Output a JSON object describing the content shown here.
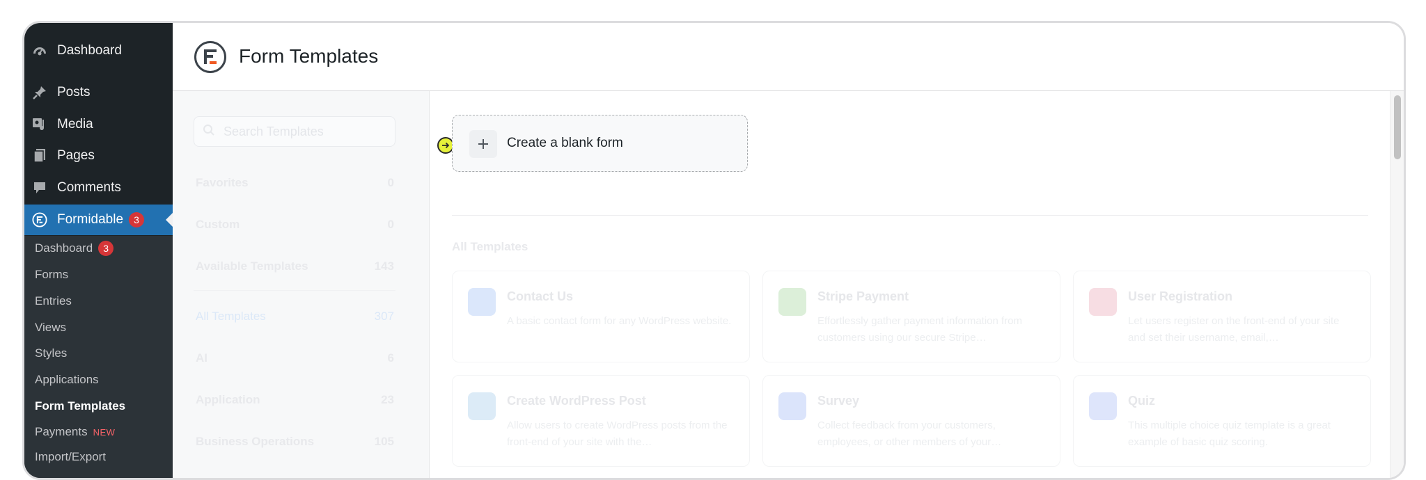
{
  "sidebar": {
    "menu": [
      {
        "label": "Dashboard",
        "icon": "dashboard-icon"
      },
      {
        "label": "Posts",
        "icon": "pin-icon"
      },
      {
        "label": "Media",
        "icon": "media-icon"
      },
      {
        "label": "Pages",
        "icon": "pages-icon"
      },
      {
        "label": "Comments",
        "icon": "comment-icon"
      },
      {
        "label": "Formidable",
        "icon": "formidable-icon",
        "badge": "3"
      }
    ],
    "submenu": [
      {
        "label": "Dashboard",
        "badge": "3"
      },
      {
        "label": "Forms"
      },
      {
        "label": "Entries"
      },
      {
        "label": "Views"
      },
      {
        "label": "Styles"
      },
      {
        "label": "Applications"
      },
      {
        "label": "Form Templates"
      },
      {
        "label": "Payments",
        "tag": "NEW"
      },
      {
        "label": "Import/Export"
      }
    ]
  },
  "header": {
    "title": "Form Templates",
    "logo_icon": "formidable-logo-icon"
  },
  "templates_panel": {
    "search_placeholder": "Search Templates",
    "categories": [
      {
        "label": "Favorites",
        "count": "0"
      },
      {
        "label": "Custom",
        "count": "0"
      },
      {
        "label": "Available Templates",
        "count": "143"
      },
      {
        "label": "All Templates",
        "count": "307"
      },
      {
        "label": "AI",
        "count": "6"
      },
      {
        "label": "Application",
        "count": "23"
      },
      {
        "label": "Business Operations",
        "count": "105"
      }
    ]
  },
  "main": {
    "blank_form_label": "Create a blank form",
    "section_title": "All Templates",
    "templates": [
      {
        "name": "Contact Us",
        "description": "A basic contact form for any WordPress website.",
        "icon_color": "#dbe7fb"
      },
      {
        "name": "Stripe Payment",
        "description": "Effortlessly gather payment information from customers using our secure Stripe…",
        "icon_color": "#dcefd9"
      },
      {
        "name": "User Registration",
        "description": "Let users register on the front-end of your site and set their username, email,…",
        "icon_color": "#f7dde3"
      },
      {
        "name": "Create WordPress Post",
        "description": "Allow users to create WordPress posts from the front-end of your site with the…",
        "icon_color": "#dcebf7"
      },
      {
        "name": "Survey",
        "description": "Collect feedback from your customers, employees, or other members of your…",
        "icon_color": "#dbe4fb"
      },
      {
        "name": "Quiz",
        "description": "This multiple choice quiz template is a great example of basic quiz scoring.",
        "icon_color": "#dee5fb"
      }
    ]
  },
  "colors": {
    "sidebar_bg": "#1d2327",
    "submenu_bg": "#2c3338",
    "active_bg": "#2271b1",
    "badge_bg": "#d63638",
    "cursor_highlight": "#e6f23a"
  }
}
